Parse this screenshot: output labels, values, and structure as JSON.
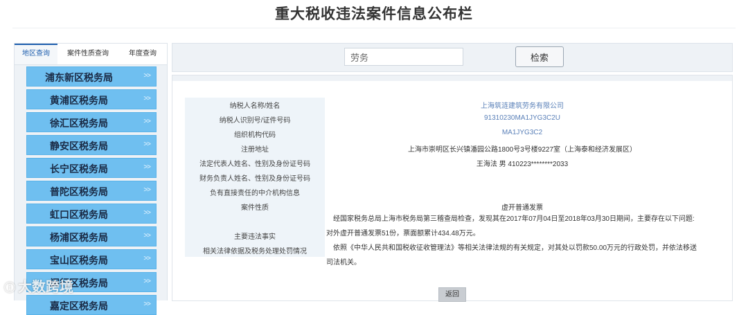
{
  "page": {
    "title": "重大税收违法案件信息公布栏"
  },
  "sidebar": {
    "tabs": [
      {
        "label": "地区查询",
        "active": true
      },
      {
        "label": "案件性质查询",
        "active": false
      },
      {
        "label": "年度查询",
        "active": false
      }
    ],
    "items": [
      {
        "label": "浦东新区税务局",
        "arrow": ">>"
      },
      {
        "label": "黄浦区税务局",
        "arrow": ">>"
      },
      {
        "label": "徐汇区税务局",
        "arrow": ">>"
      },
      {
        "label": "静安区税务局",
        "arrow": ">>"
      },
      {
        "label": "长宁区税务局",
        "arrow": ">>"
      },
      {
        "label": "普陀区税务局",
        "arrow": ">>"
      },
      {
        "label": "虹口区税务局",
        "arrow": ">>"
      },
      {
        "label": "杨浦区税务局",
        "arrow": ">>"
      },
      {
        "label": "宝山区税务局",
        "arrow": ">>"
      },
      {
        "label": "闵行区税务局",
        "arrow": ">>"
      },
      {
        "label": "嘉定区税务局",
        "arrow": ">>"
      }
    ]
  },
  "search": {
    "value": "劳务",
    "button_label": "检索"
  },
  "detail": {
    "labels": {
      "taxpayer_name": "纳税人名称/姓名",
      "taxpayer_id": "纳税人识别号/证件号码",
      "org_code": "组织机构代码",
      "address": "注册地址",
      "legal_rep": "法定代表人姓名、性别及身份证号码",
      "finance_head": "财务负责人姓名、性别及身份证号码",
      "agency": "负有直接责任的中介机构信息",
      "case_nature": "案件性质",
      "main_facts": "主要违法事实",
      "penalty": "相关法律依据及税务处理处罚情况"
    },
    "values": {
      "taxpayer_name": "上海筑涟建筑劳务有限公司",
      "taxpayer_id": "91310230MA1JYG3C2U",
      "org_code": "MA1JYG3C2",
      "address": "上海市崇明区长兴镇潘园公路1800号3号楼9227室（上海泰和经济发展区）",
      "legal_rep": "王海法 男 410223********2033",
      "case_nature": "虚开普通发票",
      "main_facts_line1": "经国家税务总局上海市税务局第三稽查局检查，发现其在2017年07月04日至2018年03月30日期间，主要存在以下问题:",
      "main_facts_line2": "对外虚开普通发票51份，票面额累计434.48万元。",
      "penalty_line1": "依照《中华人民共和国税收征收管理法》等相关法律法规的有关规定，对其处以罚款50.00万元的行政处罚，并依法移送",
      "penalty_line2": "司法机关。"
    },
    "back_label": "返回"
  },
  "watermark": {
    "text": "大数跨境"
  }
}
